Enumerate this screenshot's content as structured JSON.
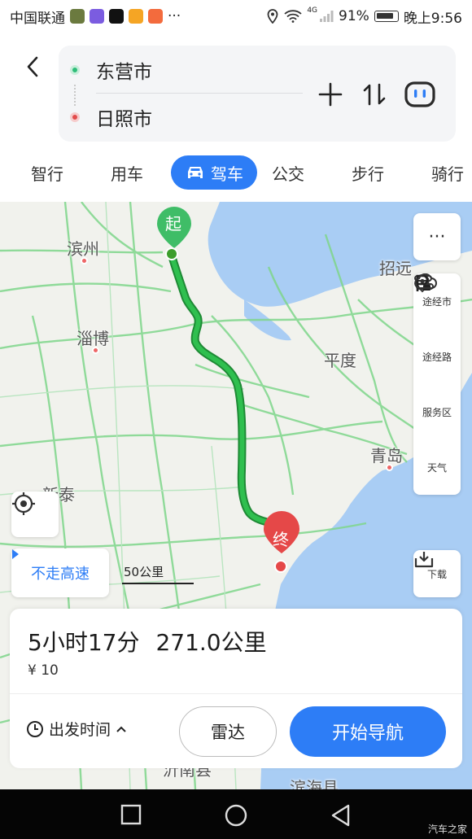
{
  "status_bar": {
    "carrier": "中国联通",
    "more": "···",
    "network": "4G",
    "battery": "91%",
    "time": "晚上9:56"
  },
  "route": {
    "origin": "东营市",
    "destination": "日照市"
  },
  "modes": {
    "items": [
      "智行",
      "用车",
      "驾车",
      "公交",
      "步行",
      "骑行"
    ],
    "active": "驾车"
  },
  "map": {
    "start_marker": "起",
    "end_marker": "终",
    "cities": [
      "滨州",
      "淄博",
      "平度",
      "青岛",
      "招远",
      "新泰",
      "沂南县",
      "滨海县"
    ],
    "scale_label": "50公里",
    "no_highway": "不走高速"
  },
  "side_tools": {
    "more": "···",
    "via_city": "途经市",
    "via_road": "途经路",
    "service_area": "服务区",
    "weather": "天气",
    "download": "下载"
  },
  "result": {
    "duration": "5小时17分",
    "distance": "271.0公里",
    "toll": "¥ 10",
    "depart_time": "出发时间",
    "radar": "雷达",
    "start_nav": "开始导航"
  },
  "watermark": "汽车之家",
  "colors": {
    "accent": "#2d7df6",
    "route": "#1aa33a",
    "start": "#2ebd79",
    "end": "#e54848"
  }
}
